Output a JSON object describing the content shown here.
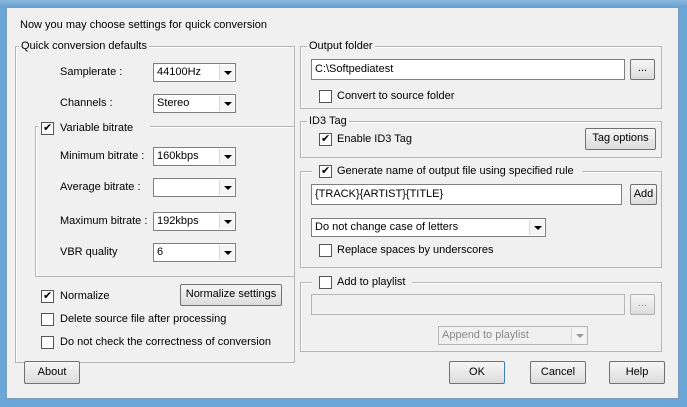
{
  "header": {
    "title": "Now you may choose settings for quick conversion"
  },
  "quick_defaults": {
    "title": "Quick conversion defaults",
    "samplerate_label": "Samplerate :",
    "samplerate_value": "44100Hz",
    "channels_label": "Channels :",
    "channels_value": "Stereo",
    "vbr": {
      "label": "Variable bitrate",
      "checked": true,
      "min_label": "Minimum bitrate :",
      "min_value": "160kbps",
      "avg_label": "Average bitrate :",
      "avg_value": "",
      "max_label": "Maximum bitrate :",
      "max_value": "192kbps",
      "quality_label": "VBR quality",
      "quality_value": "6"
    },
    "normalize_label": "Normalize",
    "normalize_checked": true,
    "normalize_settings_label": "Normalize settings",
    "delete_source_label": "Delete source file after processing",
    "no_check_label": "Do not check the correctness of conversion"
  },
  "output_folder": {
    "title": "Output folder",
    "path": "C:\\Softpediatest",
    "browse_label": "...",
    "convert_to_source_label": "Convert to source folder"
  },
  "id3": {
    "title": "ID3 Tag",
    "enable_label": "Enable ID3 Tag",
    "enable_checked": true,
    "tag_options_label": "Tag options"
  },
  "naming": {
    "title": "Generate name of output file using specified rule",
    "checked": true,
    "rule": "{TRACK}{ARTIST}{TITLE}",
    "add_label": "Add",
    "case_value": "Do not change case of letters",
    "replace_spaces_label": "Replace spaces by underscores"
  },
  "playlist": {
    "title": "Add to playlist",
    "checked": false,
    "browse_label": "...",
    "mode_value": "Append to playlist"
  },
  "footer": {
    "about_label": "About",
    "ok_label": "OK",
    "cancel_label": "Cancel",
    "help_label": "Help"
  },
  "colors": {
    "dialog_bg": "#f0f0f0",
    "frame": "#6aa7d8"
  }
}
